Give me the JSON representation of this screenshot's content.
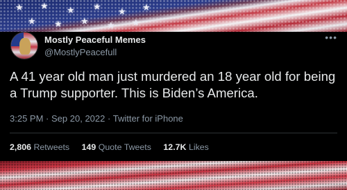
{
  "tweet": {
    "display_name": "Mostly Peaceful Memes",
    "handle": "@MostlyPeacefull",
    "more_icon": "more-dots-icon",
    "text": "A 41 year old man just murdered an 18 year old for being a Trump supporter. This is Biden’s America.",
    "time": "3:25 PM",
    "date": "Sep 20, 2022",
    "source": "Twitter for iPhone",
    "separator": "·"
  },
  "stats": {
    "retweets_count": "2,806",
    "retweets_label": "Retweets",
    "quotes_count": "149",
    "quotes_label": "Quote Tweets",
    "likes_count": "12.7K",
    "likes_label": "Likes"
  },
  "colors": {
    "background": "#000000",
    "primary_text": "#e7e9ea",
    "secondary_text": "#8b98a5",
    "divider": "#2f3336",
    "flag_blue": "#1b2a6e",
    "flag_red": "#c43a45"
  }
}
